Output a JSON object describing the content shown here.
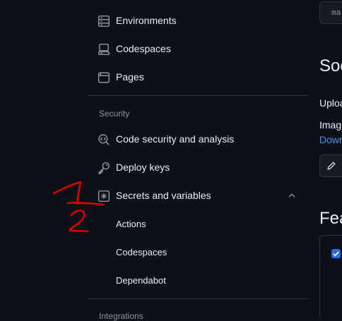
{
  "sidebar": {
    "items_top": [
      {
        "label": "Environments",
        "icon": "server-icon"
      },
      {
        "label": "Codespaces",
        "icon": "codespaces-icon"
      },
      {
        "label": "Pages",
        "icon": "browser-icon"
      }
    ],
    "security_section": {
      "title": "Security",
      "items": [
        {
          "label": "Code security and analysis",
          "icon": "codescan-icon"
        },
        {
          "label": "Deploy keys",
          "icon": "key-icon"
        },
        {
          "label": "Secrets and variables",
          "icon": "asterisk-icon",
          "expanded": true
        }
      ],
      "subitems": [
        {
          "label": "Actions"
        },
        {
          "label": "Codespaces"
        },
        {
          "label": "Dependabot"
        }
      ]
    },
    "integrations_section": {
      "title": "Integrations"
    }
  },
  "content": {
    "code_pill": "ma",
    "heading1": "Soc",
    "text1": "Uploa",
    "text2": "Imag",
    "link1": "Dowr",
    "heading2": "Fea"
  },
  "annotations": [
    {
      "text": "1",
      "color": "#e00000"
    },
    {
      "text": "2",
      "color": "#e00000"
    }
  ],
  "colors": {
    "background": "#0d1117",
    "text": "#e6edf3",
    "muted": "#8b949e",
    "border": "#30363d",
    "link": "#4493f8",
    "accent": "#1f6feb"
  }
}
